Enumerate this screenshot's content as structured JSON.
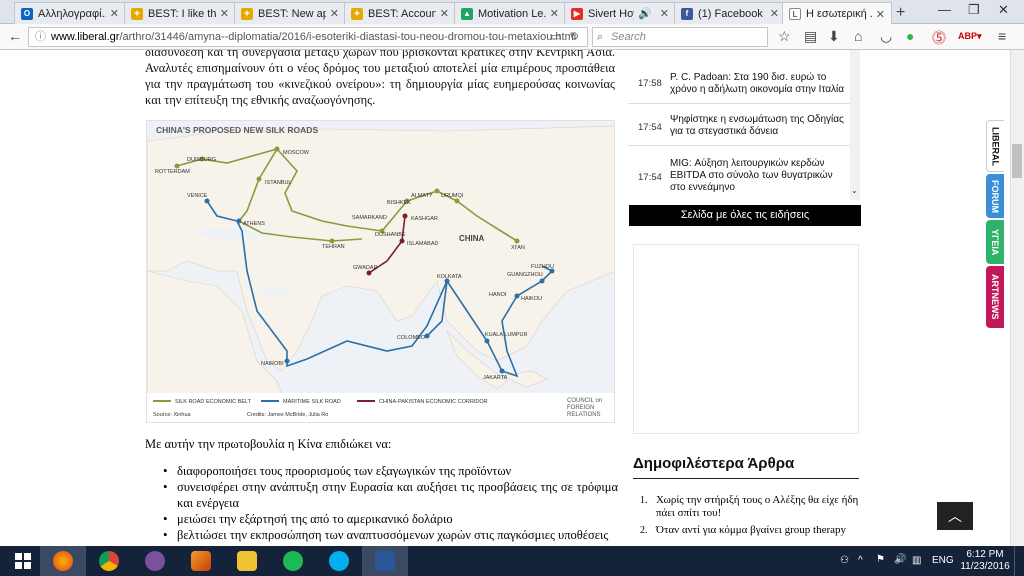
{
  "browser": {
    "tabs": [
      {
        "label": "Αλληλογραφί...",
        "icon": "outlook-icon",
        "color": "#0a64c2",
        "active": false
      },
      {
        "label": "BEST: I like th...",
        "icon": "best-icon",
        "color": "#e8a800",
        "active": false
      },
      {
        "label": "BEST: New ap...",
        "icon": "best-icon",
        "color": "#e8a800",
        "active": false
      },
      {
        "label": "BEST: Accoun...",
        "icon": "best-icon",
        "color": "#e8a800",
        "active": false
      },
      {
        "label": "Motivation Le...",
        "icon": "drive-icon",
        "color": "#1fa463",
        "active": false
      },
      {
        "label": "Sivert Hoy...",
        "icon": "youtube-icon",
        "color": "#e52d27",
        "active": false
      },
      {
        "label": "(1) Facebook",
        "icon": "facebook-icon",
        "color": "#3b5998",
        "active": false
      },
      {
        "label": "Η εσωτερική ...",
        "icon": "page-icon",
        "color": "#666666",
        "active": true
      }
    ],
    "url_host": "www.liberal.gr",
    "url_path": "/arthro/31446/amyna--diplomatia/2016/i-esoteriki-diastasi-tou-neou-dromou-tou-metaxiou.html",
    "search_placeholder": "Search"
  },
  "article": {
    "lead_top": "διασύνδεση και τη συνεργασία μεταξύ χωρών που βρίσκονται κρατικές στην Κεντρική Ασία.",
    "lead": "Αναλυτές επισημαίνουν ότι ο νέος δρόμος του μεταξιού αποτελεί μία επιμέρους προσπάθεια για την πραγμάτωση του «κινεζικού ονείρου»: τη δημιουργία μίας ευημερούσας κοινωνίας και την επίτευξη της εθνικής αναζωογόνησης.",
    "map": {
      "title": "CHINA'S PROPOSED NEW SILK ROADS",
      "legend": [
        "SILK ROAD ECONOMIC BELT",
        "MARITIME SILK ROAD",
        "CHINA-PAKISTAN ECONOMIC CORRIDOR"
      ],
      "colors": {
        "belt": "#8c9a3c",
        "maritime": "#2a6fa8",
        "corridor": "#7a1f2e"
      },
      "source": "Source: Xinhua",
      "credits": "Credits: James McBride, Julia Ro",
      "brand": [
        "COUNCIL on",
        "FOREIGN",
        "RELATIONS"
      ],
      "cities": {
        "moscow": "MOSCOW",
        "duisburg": "DUISBURG",
        "rotterdam": "ROTTERDAM",
        "venice": "VENICE",
        "athens": "ATHENS",
        "istanbul": "ISTANBUL",
        "tehran": "TEHRAN",
        "samarkand": "SAMARKAND",
        "bishkek": "BISHKEK",
        "almaty": "ALMATY",
        "urumqi": "URUMQI",
        "dushanbe": "DUSHANBE",
        "kashgar": "KASHGAR",
        "islamabad": "ISLAMABAD",
        "gwadar": "GWADAR",
        "xian": "XI'AN",
        "china": "CHINA",
        "kolkata": "KOLKATA",
        "guangzhou": "GUANGZHOU",
        "fuzhou": "FUZHOU",
        "hanoi": "HANOI",
        "haikou": "HAIKOU",
        "colombo": "COLOMBO",
        "kuala_lumpur": "KUALA LUMPUR",
        "jakarta": "JAKARTA",
        "nairobi": "NAIROBI"
      }
    },
    "intro": "Με αυτήν την πρωτοβουλία η Κίνα επιδιώκει να:",
    "bullets": [
      " διαφοροποιήσει τους προορισμούς των εξαγωγικών της προϊόντων",
      "συνεισφέρει στην ανάπτυξη στην Ευρασία και αυξήσει τις προσβάσεις της σε τρόφιμα και ενέργεια",
      "μειώσει την εξάρτησή της από το αμερικανικό δολάριο",
      "βελτιώσει την εκπροσώπηση των αναπτυσσόμενων χωρών στις παγκόσμιες υποθέσεις"
    ]
  },
  "sidebar": {
    "news": [
      {
        "time": "17:58",
        "headline": "P. C. Padoan: Στα 190 δισ. ευρώ το χρόνο η αδήλωτη οικονομία στην Ιταλία"
      },
      {
        "time": "17:54",
        "headline": "Ψηφίστηκε η ενσωμάτωση της Οδηγίας για τα στεγαστικά δάνεια"
      },
      {
        "time": "17:54",
        "headline": "MIG: Αύξηση λειτουργικών κερδών EBITDA στο σύνολο των θυγατρικών στο εννεάμηνο"
      }
    ],
    "all_news": "Σελίδα με όλες τις ειδήσεις",
    "popular_title": "Δημοφιλέστερα Άρθρα",
    "popular": [
      {
        "n": "1.",
        "title": "Χωρίς την στήριξή τους ο Αλέξης θα είχε ήδη πάει σπίτι του!"
      },
      {
        "n": "2.",
        "title": "Όταν αντί για κόμμα βγαίνει group therapy"
      }
    ],
    "side_tabs": [
      {
        "label": "LIBERAL",
        "color": "#ffffff",
        "text": "#111111"
      },
      {
        "label": "FORUM",
        "color": "#3a8fd6",
        "text": "#ffffff"
      },
      {
        "label": "ΥΓΕΙΑ",
        "color": "#2fb36a",
        "text": "#ffffff"
      },
      {
        "label": "ARTNEWS",
        "color": "#c2185b",
        "text": "#ffffff"
      }
    ]
  },
  "taskbar": {
    "apps": [
      "firefox-icon",
      "chrome-icon",
      "viber-icon",
      "matlab-icon",
      "file-explorer-icon",
      "spotify-icon",
      "skype-icon",
      "word-icon"
    ],
    "tray_lang": "ENG",
    "time": "6:12 PM",
    "date": "11/23/2016"
  }
}
